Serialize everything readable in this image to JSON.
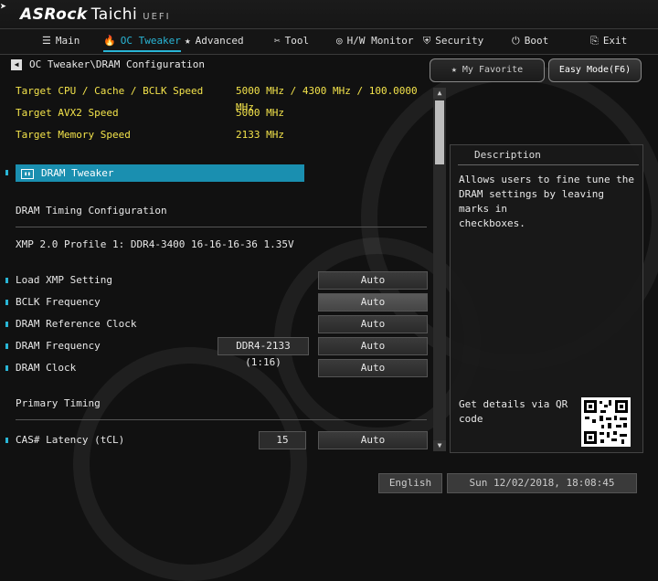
{
  "brand": {
    "name": "ASRock",
    "model": "Taichi",
    "firmware": "UEFI"
  },
  "nav": [
    {
      "label": "Main",
      "icon": "list-icon",
      "glyph": "☰",
      "active": false
    },
    {
      "label": "OC Tweaker",
      "icon": "flame-icon",
      "glyph": "🔥",
      "active": true
    },
    {
      "label": "Advanced",
      "icon": "star-icon",
      "glyph": "★",
      "active": false
    },
    {
      "label": "Tool",
      "icon": "tools-icon",
      "glyph": "✂",
      "active": false
    },
    {
      "label": "H/W Monitor",
      "icon": "monitor-icon",
      "glyph": "◎",
      "active": false
    },
    {
      "label": "Security",
      "icon": "shield-icon",
      "glyph": "⛨",
      "active": false
    },
    {
      "label": "Boot",
      "icon": "power-icon",
      "glyph": "⏻",
      "active": false
    },
    {
      "label": "Exit",
      "icon": "exit-icon",
      "glyph": "⎘",
      "active": false
    }
  ],
  "breadcrumb": "OC Tweaker\\DRAM Configuration",
  "buttons": {
    "favorite": "My Favorite",
    "easy_mode": "Easy Mode(F6)"
  },
  "targets": [
    {
      "label": "Target CPU / Cache / BCLK Speed",
      "value": "5000 MHz / 4300 MHz / 100.0000 MHz"
    },
    {
      "label": "Target AVX2 Speed",
      "value": "5000 MHz"
    },
    {
      "label": "Target Memory Speed",
      "value": "2133 MHz"
    }
  ],
  "dram_tweaker": {
    "label": "DRAM Tweaker",
    "icon": "dram-icon"
  },
  "section_timing_config": "DRAM Timing Configuration",
  "xmp_profile": "XMP 2.0 Profile 1: DDR4-3400 16-16-16-36 1.35V",
  "settings": [
    {
      "label": "Load XMP Setting",
      "value": "Auto",
      "sub": ""
    },
    {
      "label": "BCLK Frequency",
      "value": "Auto",
      "sub": ""
    },
    {
      "label": "DRAM Reference Clock",
      "value": "Auto",
      "sub": ""
    },
    {
      "label": "DRAM Frequency",
      "value": "Auto",
      "sub": "DDR4-2133 (1:16)"
    },
    {
      "label": "DRAM Clock",
      "value": "Auto",
      "sub": ""
    }
  ],
  "section_primary": "Primary Timing",
  "cas": {
    "label": "CAS# Latency (tCL)",
    "current": "15",
    "value": "Auto"
  },
  "description": {
    "title": "Description",
    "text": "Allows users to fine tune the\nDRAM settings by leaving marks in\ncheckboxes.",
    "qr_text": "Get details via QR\ncode"
  },
  "footer": {
    "language": "English",
    "datetime": "Sun 12/02/2018, 18:08:45"
  }
}
